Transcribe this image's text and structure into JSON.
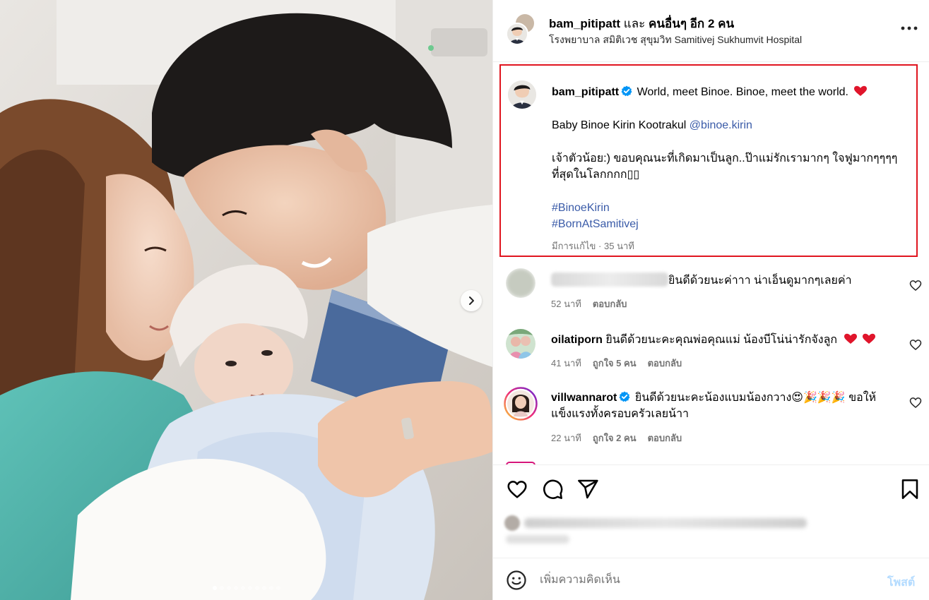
{
  "colors": {
    "verified": "#0095f6",
    "link": "#3a5ba8",
    "highlight_border": "#e0151f",
    "heart_red": "#e0152b",
    "post_disabled": "#b3dbff"
  },
  "photo": {
    "carousel_total": 10,
    "carousel_active": 1,
    "next_icon": "chevron-right-icon"
  },
  "header": {
    "username": "bam_pitipatt",
    "and_text": "และ",
    "others_text": "คนอื่นๆ อีก 2 คน",
    "location": "โรงพยาบาล สมิติเวช สุขุมวิท Samitivej Sukhumvit Hospital",
    "more_icon": "more-horizontal-icon"
  },
  "caption": {
    "username": "bam_pitipatt",
    "line1": "World, meet Binoe. Binoe, meet the world.",
    "line2_text": "Baby Binoe Kirin Kootrakul",
    "line2_mention": "@binoe.kirin",
    "line3": "เจ้าตัวน้อย:) ขอบคุณนะที่เกิดมาเป็นลูก..ป๊าแม่รักเรามากๆ ใจฟูมากๆๆๆๆที่สุดในโลกกกก▯▯",
    "hashtag1": "#BinoeKirin",
    "hashtag2": "#BornAtSamitivej",
    "edited": "มีการแก้ไข",
    "separator": "·",
    "time": "35 นาที"
  },
  "comments": [
    {
      "username": "",
      "text": "ยินดีด้วยนะค่าาา น่าเอ็นดูมากๆเลยค่า",
      "time": "52 นาที",
      "likes": "",
      "reply": "ตอบกลับ"
    },
    {
      "username": "oilatiporn",
      "text": "ยินดีด้วยนะคะคุณพ่อคุณแม่ น้องบีโน่น่ารักจังลูก",
      "time": "41 นาที",
      "likes": "ถูกใจ 5 คน",
      "reply": "ตอบกลับ"
    },
    {
      "username": "villwannarot",
      "text": "ยินดีด้วยนะคะน้องแบมน้องกวาง😍🎉🎉🎉 ขอให้แข็งแรงทั้งครอบครัวเลยน้าา",
      "time": "22 นาที",
      "likes": "ถูกใจ 2 คน",
      "reply": "ตอบกลับ"
    }
  ],
  "actions": {
    "like_icon": "heart-icon",
    "comment_icon": "comment-icon",
    "share_icon": "share-icon",
    "save_icon": "bookmark-icon"
  },
  "add_comment": {
    "placeholder": "เพิ่มความคิดเห็น",
    "post_label": "โพสต์",
    "emoji_icon": "emoji-icon"
  }
}
